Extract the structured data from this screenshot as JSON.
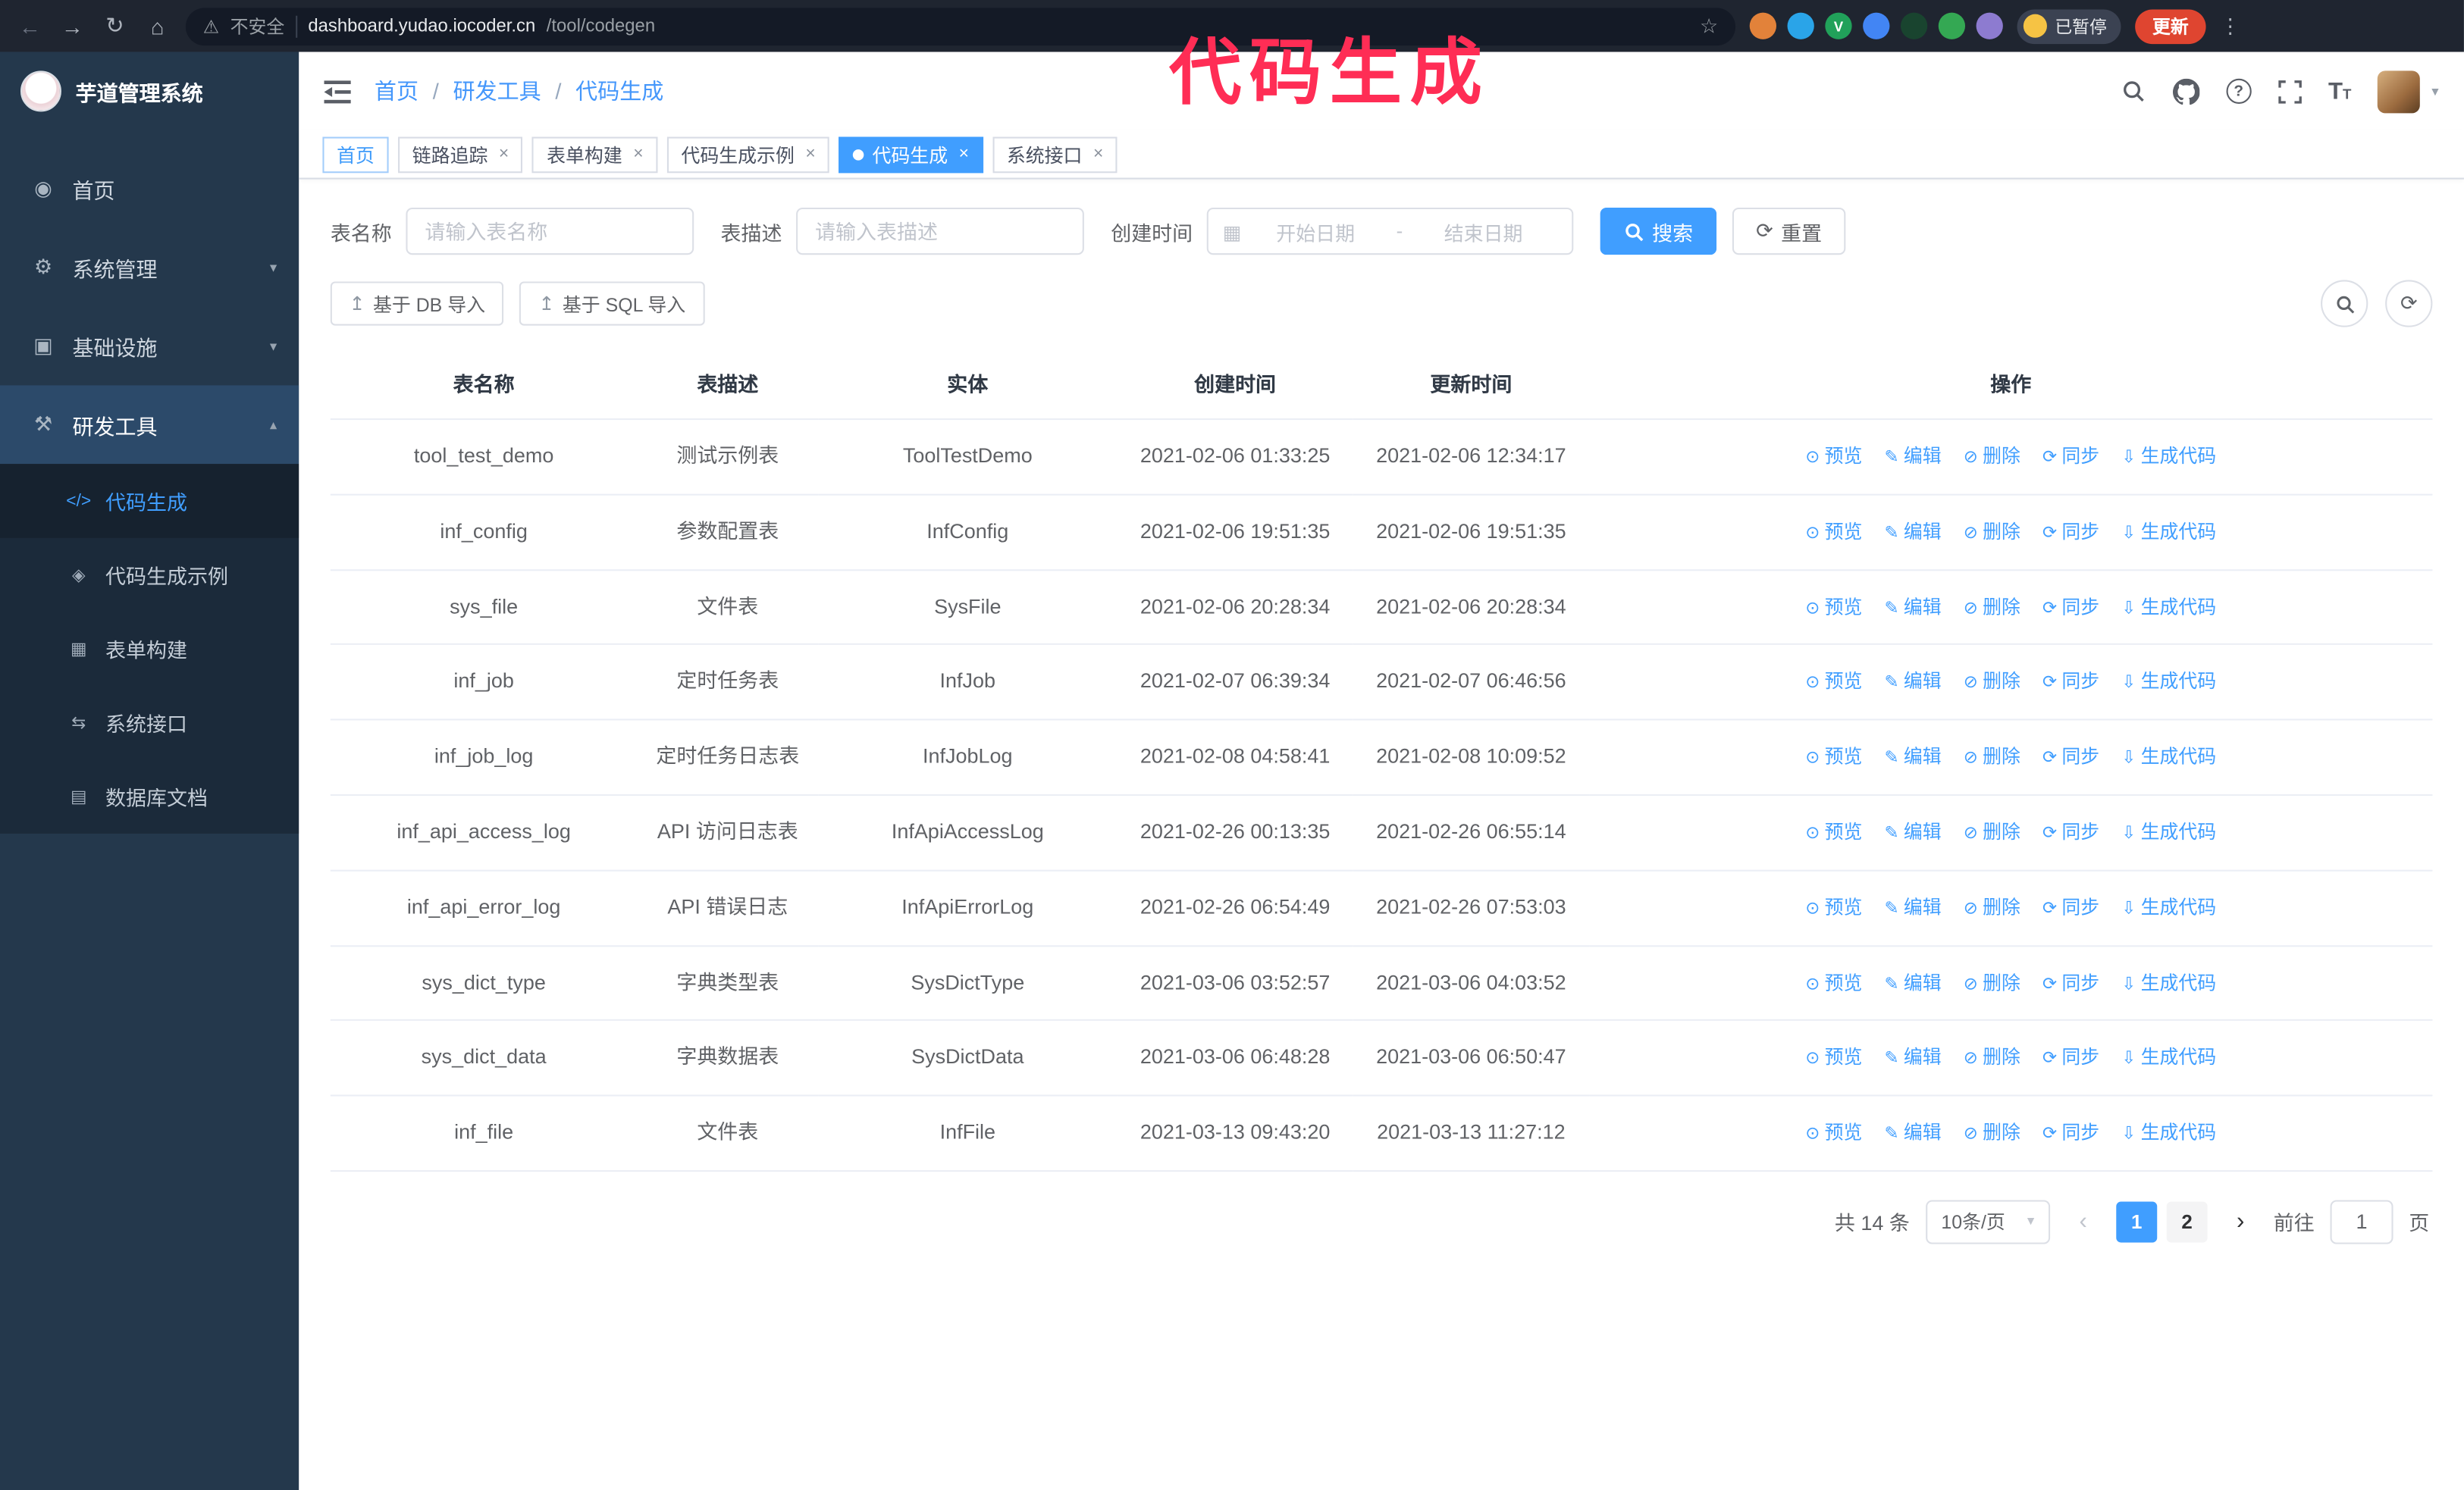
{
  "annotation": {
    "text": "代码生成",
    "color": "#ff2d55"
  },
  "browser": {
    "warning_text": "不安全",
    "url_host": "dashboard.yudao.iocoder.cn",
    "url_path": "/tool/codegen",
    "paused_badge": "已暂停",
    "update_button": "更新",
    "extensions": [
      {
        "name": "ext-fox",
        "color": "#e2823a"
      },
      {
        "name": "ext-drop",
        "color": "#2aa4e8"
      },
      {
        "name": "ext-check",
        "color": "#21a15a",
        "glyph": "V"
      },
      {
        "name": "ext-people",
        "color": "#4285f4"
      },
      {
        "name": "ext-dark",
        "color": "#19442f"
      },
      {
        "name": "ext-leaf",
        "color": "#34a853"
      },
      {
        "name": "ext-puzzle",
        "color": "#8d7bd0"
      }
    ]
  },
  "sidebar": {
    "logo_title": "芋道管理系统",
    "items": [
      {
        "id": "home",
        "label": "首页",
        "icon": "dashboard"
      },
      {
        "id": "system",
        "label": "系统管理",
        "icon": "system",
        "caret": "down"
      },
      {
        "id": "infra",
        "label": "基础设施",
        "icon": "infrastructure",
        "caret": "down"
      },
      {
        "id": "devtools",
        "label": "研发工具",
        "icon": "dev-tools",
        "caret": "up",
        "open": true
      }
    ],
    "submenu": [
      {
        "id": "codegen",
        "label": "代码生成",
        "icon": "code",
        "active": true
      },
      {
        "id": "codegen-demo",
        "label": "代码生成示例",
        "icon": "code-example"
      },
      {
        "id": "form-builder",
        "label": "表单构建",
        "icon": "form-builder"
      },
      {
        "id": "api",
        "label": "系统接口",
        "icon": "api"
      },
      {
        "id": "db-doc",
        "label": "数据库文档",
        "icon": "database-doc"
      }
    ]
  },
  "header": {
    "breadcrumb": [
      "首页",
      "研发工具",
      "代码生成"
    ]
  },
  "tabs": [
    {
      "id": "home",
      "label": "首页",
      "pinned": true
    },
    {
      "id": "trace",
      "label": "链路追踪",
      "closable": true
    },
    {
      "id": "form-builder",
      "label": "表单构建",
      "closable": true
    },
    {
      "id": "codegen-demo",
      "label": "代码生成示例",
      "closable": true
    },
    {
      "id": "codegen",
      "label": "代码生成",
      "closable": true,
      "active": true
    },
    {
      "id": "api",
      "label": "系统接口",
      "closable": true
    }
  ],
  "filters": {
    "table_name_label": "表名称",
    "table_name_placeholder": "请输入表名称",
    "table_desc_label": "表描述",
    "table_desc_placeholder": "请输入表描述",
    "create_time_label": "创建时间",
    "date_start_placeholder": "开始日期",
    "date_separator": "-",
    "date_end_placeholder": "结束日期",
    "search_button": "搜索",
    "reset_button": "重置"
  },
  "toolbar": {
    "import_db": "基于 DB 导入",
    "import_sql": "基于 SQL 导入"
  },
  "table": {
    "columns": [
      "表名称",
      "表描述",
      "实体",
      "创建时间",
      "更新时间",
      "操作"
    ],
    "actions": [
      {
        "id": "preview",
        "label": "预览",
        "icon": "eye"
      },
      {
        "id": "edit",
        "label": "编辑",
        "icon": "edit"
      },
      {
        "id": "delete",
        "label": "删除",
        "icon": "trash"
      },
      {
        "id": "sync",
        "label": "同步",
        "icon": "sync"
      },
      {
        "id": "generate",
        "label": "生成代码",
        "icon": "download"
      }
    ],
    "rows": [
      {
        "name": "tool_test_demo",
        "desc": "测试示例表",
        "entity": "ToolTestDemo",
        "created": "2021-02-06 01:33:25",
        "updated": "2021-02-06 12:34:17"
      },
      {
        "name": "inf_config",
        "desc": "参数配置表",
        "entity": "InfConfig",
        "created": "2021-02-06 19:51:35",
        "updated": "2021-02-06 19:51:35"
      },
      {
        "name": "sys_file",
        "desc": "文件表",
        "entity": "SysFile",
        "created": "2021-02-06 20:28:34",
        "updated": "2021-02-06 20:28:34"
      },
      {
        "name": "inf_job",
        "desc": "定时任务表",
        "entity": "InfJob",
        "created": "2021-02-07 06:39:34",
        "updated": "2021-02-07 06:46:56"
      },
      {
        "name": "inf_job_log",
        "desc": "定时任务日志表",
        "entity": "InfJobLog",
        "created": "2021-02-08 04:58:41",
        "updated": "2021-02-08 10:09:52"
      },
      {
        "name": "inf_api_access_log",
        "desc": "API 访问日志表",
        "entity": "InfApiAccessLog",
        "created": "2021-02-26 00:13:35",
        "updated": "2021-02-26 06:55:14"
      },
      {
        "name": "inf_api_error_log",
        "desc": "API 错误日志",
        "entity": "InfApiErrorLog",
        "created": "2021-02-26 06:54:49",
        "updated": "2021-02-26 07:53:03"
      },
      {
        "name": "sys_dict_type",
        "desc": "字典类型表",
        "entity": "SysDictType",
        "created": "2021-03-06 03:52:57",
        "updated": "2021-03-06 04:03:52"
      },
      {
        "name": "sys_dict_data",
        "desc": "字典数据表",
        "entity": "SysDictData",
        "created": "2021-03-06 06:48:28",
        "updated": "2021-03-06 06:50:47"
      },
      {
        "name": "inf_file",
        "desc": "文件表",
        "entity": "InfFile",
        "created": "2021-03-13 09:43:20",
        "updated": "2021-03-13 11:27:12"
      }
    ]
  },
  "pagination": {
    "total_text": "共 14 条",
    "page_size": "10条/页",
    "pages": [
      "1",
      "2"
    ],
    "active_page": "1",
    "goto_label": "前往",
    "goto_value": "1",
    "goto_suffix": "页"
  },
  "icon_glyphs": {
    "dashboard": "◉",
    "system": "⚙",
    "infrastructure": "▣",
    "dev-tools": "⚒",
    "code": "</>",
    "code-example": "◈",
    "form-builder": "▦",
    "api": "⇆",
    "database-doc": "▤",
    "eye": "⊙",
    "edit": "✎",
    "trash": "⊘",
    "sync": "⟳",
    "download": "⇩",
    "calendar": "▦",
    "upload": "↥",
    "refresh": "⟳",
    "caret-down": "▾",
    "caret-up": "▴"
  },
  "colors": {
    "accent": "#409eff",
    "annotation": "#ff2d55"
  }
}
